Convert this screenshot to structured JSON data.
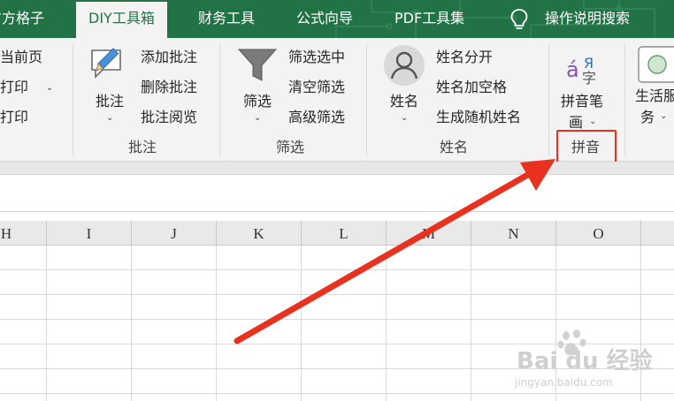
{
  "tabs": [
    {
      "id": "fangge",
      "label": "方方格子",
      "active": false
    },
    {
      "id": "diy",
      "label": "DIY工具箱",
      "active": true
    },
    {
      "id": "finance",
      "label": "财务工具",
      "active": false
    },
    {
      "id": "formula",
      "label": "公式向导",
      "active": false
    },
    {
      "id": "pdf",
      "label": "PDF工具集",
      "active": false
    },
    {
      "id": "help",
      "label": "操作说明搜索",
      "active": false
    }
  ],
  "ribbon": {
    "print_group": {
      "current_page": "当前页",
      "print1": "打印",
      "print2": "打印"
    },
    "comment_group": {
      "label": "批注",
      "main_button": "批注",
      "add": "添加批注",
      "delete": "删除批注",
      "view": "批注阅览"
    },
    "filter_group": {
      "label": "筛选",
      "main_button": "筛选",
      "filter_selected": "筛选选中",
      "clear": "清空筛选",
      "advanced": "高级筛选"
    },
    "name_group": {
      "label": "姓名",
      "main_button": "姓名",
      "split": "姓名分开",
      "add_space": "姓名加空格",
      "random": "生成随机姓名"
    },
    "pinyin_group": {
      "label": "拼音",
      "main_line1": "拼音笔",
      "main_line2": "画"
    },
    "life_group": {
      "main_line1": "生活服",
      "main_line2": "务"
    }
  },
  "grid": {
    "columns": [
      "H",
      "I",
      "J",
      "K",
      "L",
      "M",
      "N",
      "O"
    ]
  },
  "watermark": {
    "brand": "Bai du 经验",
    "url": "jingyan.baidu.com"
  },
  "colors": {
    "tab_bar": "#217346",
    "annotation": "#e8321f"
  }
}
